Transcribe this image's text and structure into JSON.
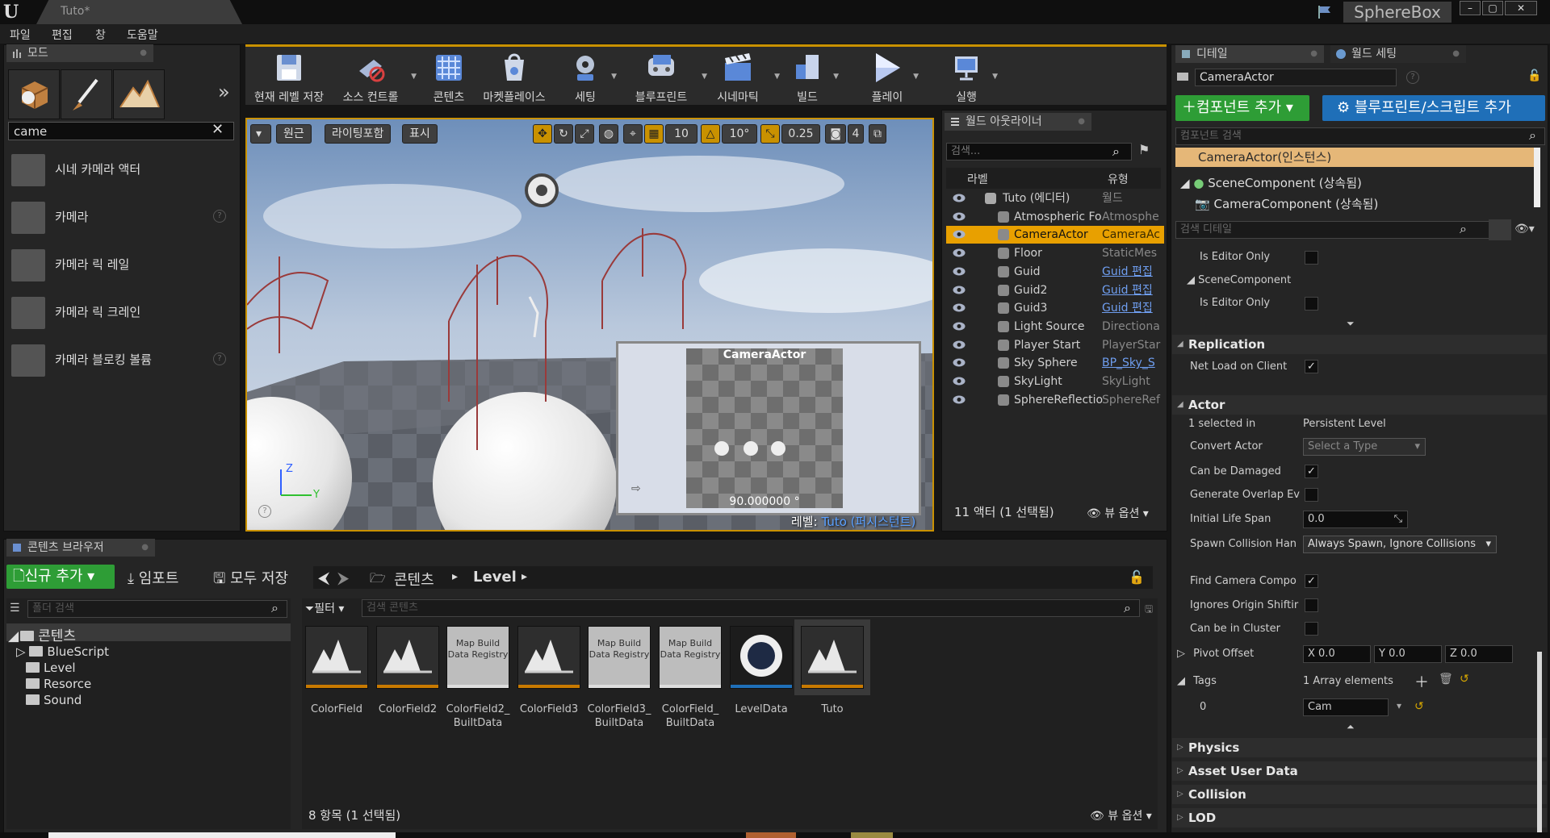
{
  "window": {
    "doc_tab": "Tuto*",
    "project_name": "SphereBox",
    "controls": [
      "–",
      "▢",
      "✕"
    ]
  },
  "menu": [
    "파일",
    "편집",
    "창",
    "도움말"
  ],
  "modes_panel": {
    "tab": "모드",
    "search_value": "came",
    "items": [
      {
        "label": "시네 카메라 액터",
        "help": false
      },
      {
        "label": "카메라",
        "help": true
      },
      {
        "label": "카메라 릭 레일",
        "help": false
      },
      {
        "label": "카메라 릭 크레인",
        "help": false
      },
      {
        "label": "카메라 블로킹 볼륨",
        "help": true
      }
    ]
  },
  "toolbar": {
    "save": "현재 레벨 저장",
    "source_control": "소스 컨트롤",
    "content": "콘텐츠",
    "marketplace": "마켓플레이스",
    "settings": "세팅",
    "blueprints": "블루프린트",
    "cinematics": "시네마틱",
    "build": "빌드",
    "play": "플레이",
    "launch": "실행"
  },
  "viewport": {
    "perspective": "원근",
    "lighting": "라이팅포함",
    "show": "표시",
    "grid_snap": "10",
    "rot_snap": "10°",
    "scale_snap": "0.25",
    "cam_speed": "4",
    "preview_title": "CameraActor",
    "preview_fov": "90.000000 °",
    "level_prefix": "레벨:",
    "level_name": "Tuto (퍼시스턴트)",
    "axis_z": "Z",
    "axis_y": "Y"
  },
  "outliner": {
    "tab": "월드 아웃라이너",
    "search_placeholder": "검색...",
    "col_label": "라벨",
    "col_type": "유형",
    "rows": [
      {
        "name": "Tuto (에디터)",
        "type": "월드",
        "link": false,
        "selected": false,
        "indent": 0
      },
      {
        "name": "Atmospheric Fo",
        "type": "Atmosphe",
        "link": false,
        "selected": false,
        "indent": 1
      },
      {
        "name": "CameraActor",
        "type": "CameraAc",
        "link": false,
        "selected": true,
        "indent": 1
      },
      {
        "name": "Floor",
        "type": "StaticMes",
        "link": false,
        "selected": false,
        "indent": 1
      },
      {
        "name": "Guid",
        "type": "Guid 편집",
        "link": true,
        "selected": false,
        "indent": 1
      },
      {
        "name": "Guid2",
        "type": "Guid 편집",
        "link": true,
        "selected": false,
        "indent": 1
      },
      {
        "name": "Guid3",
        "type": "Guid 편집",
        "link": true,
        "selected": false,
        "indent": 1
      },
      {
        "name": "Light Source",
        "type": "Directiona",
        "link": false,
        "selected": false,
        "indent": 1
      },
      {
        "name": "Player Start",
        "type": "PlayerStar",
        "link": false,
        "selected": false,
        "indent": 1
      },
      {
        "name": "Sky Sphere",
        "type": "BP_Sky_S",
        "link": true,
        "selected": false,
        "indent": 1
      },
      {
        "name": "SkyLight",
        "type": "SkyLight",
        "link": false,
        "selected": false,
        "indent": 1
      },
      {
        "name": "SphereReflectio",
        "type": "SphereRef",
        "link": false,
        "selected": false,
        "indent": 1
      }
    ],
    "status": "11 액터 (1 선택됨)",
    "view_options": "뷰 옵션"
  },
  "details": {
    "tab_details": "디테일",
    "tab_world": "월드 세팅",
    "actor_name": "CameraActor",
    "add_component": "컴포넌트 추가",
    "add_blueprint": "블루프린트/스크립트 추가",
    "component_search": "컴포넌트 검색",
    "instance": "CameraActor(인스턴스)",
    "scene_component": "SceneComponent (상속됨)",
    "camera_component": "CameraComponent (상속됨)",
    "detail_search": "검색 디테일",
    "is_editor_only_1": "Is Editor Only",
    "scene_component_group": "SceneComponent",
    "is_editor_only_2": "Is Editor Only",
    "sec_replication": "Replication",
    "net_load": "Net Load on Client",
    "sec_actor": "Actor",
    "selected_in": "1 selected in",
    "selected_in_value": "Persistent Level",
    "convert_actor": "Convert Actor",
    "convert_actor_value": "Select a Type",
    "can_be_damaged": "Can be Damaged",
    "gen_overlap": "Generate Overlap Ev",
    "initial_life": "Initial Life Span",
    "initial_life_value": "0.0",
    "spawn_collision": "Spawn Collision Han",
    "spawn_collision_value": "Always Spawn, Ignore Collisions",
    "find_camera": "Find Camera Compo",
    "ignores_origin": "Ignores Origin Shiftir",
    "can_cluster": "Can be in Cluster",
    "pivot_offset": "Pivot Offset",
    "pivot_x": "X 0.0",
    "pivot_y": "Y 0.0",
    "pivot_z": "Z 0.0",
    "tags": "Tags",
    "tags_value": "1 Array elements",
    "tag_index": "0",
    "tag_0": "Cam",
    "sec_physics": "Physics",
    "sec_asset_user": "Asset User Data",
    "sec_collision": "Collision",
    "sec_lod": "LOD"
  },
  "content_browser": {
    "tab": "콘텐츠 브라우저",
    "add_new": "신규 추가",
    "import": "임포트",
    "save_all": "모두 저장",
    "path_root": "콘텐츠",
    "path_leaf": "Level",
    "folder_search": "폴더 검색",
    "filter": "필터",
    "content_search": "검색 콘텐츠",
    "tree": [
      "콘텐츠",
      "BlueScript",
      "Level",
      "Resorce",
      "Sound"
    ],
    "assets": [
      {
        "name": "ColorField",
        "kind": "map"
      },
      {
        "name": "ColorField2",
        "kind": "map"
      },
      {
        "name": "ColorField2_ BuiltData",
        "kind": "mbd"
      },
      {
        "name": "ColorField3",
        "kind": "map"
      },
      {
        "name": "ColorField3_ BuiltData",
        "kind": "mbd"
      },
      {
        "name": "ColorField_ BuiltData",
        "kind": "mbd"
      },
      {
        "name": "LevelData",
        "kind": "ring"
      },
      {
        "name": "Tuto",
        "kind": "map"
      }
    ],
    "mbd_label": "Map Build Data Registry",
    "status": "8 항목 (1 선택됨)",
    "view_options": "뷰 옵션"
  },
  "colors": {
    "accent": "#c99100",
    "selected": "#e8a000",
    "green": "#2e9d36",
    "blue": "#1f6fb8"
  }
}
